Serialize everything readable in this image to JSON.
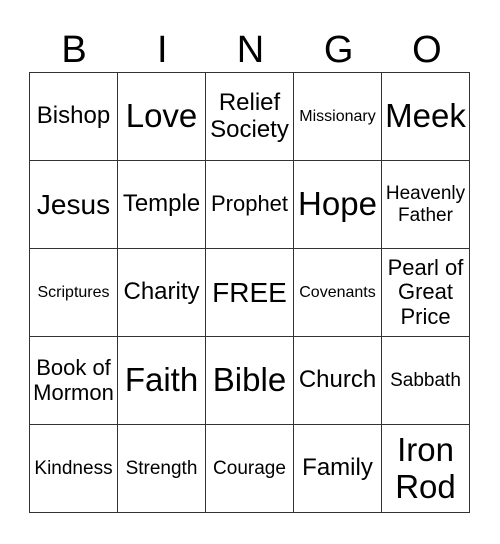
{
  "header": [
    "B",
    "I",
    "N",
    "G",
    "O"
  ],
  "cells": [
    [
      "Bishop",
      "Love",
      "Relief Society",
      "Missionary",
      "Meek"
    ],
    [
      "Jesus",
      "Temple",
      "Prophet",
      "Hope",
      "Heavenly Father"
    ],
    [
      "Scriptures",
      "Charity",
      "FREE",
      "Covenants",
      "Pearl of Great Price"
    ],
    [
      "Book of Mormon",
      "Faith",
      "Bible",
      "Church",
      "Sabbath"
    ],
    [
      "Kindness",
      "Strength",
      "Courage",
      "Family",
      "Iron Rod"
    ]
  ]
}
